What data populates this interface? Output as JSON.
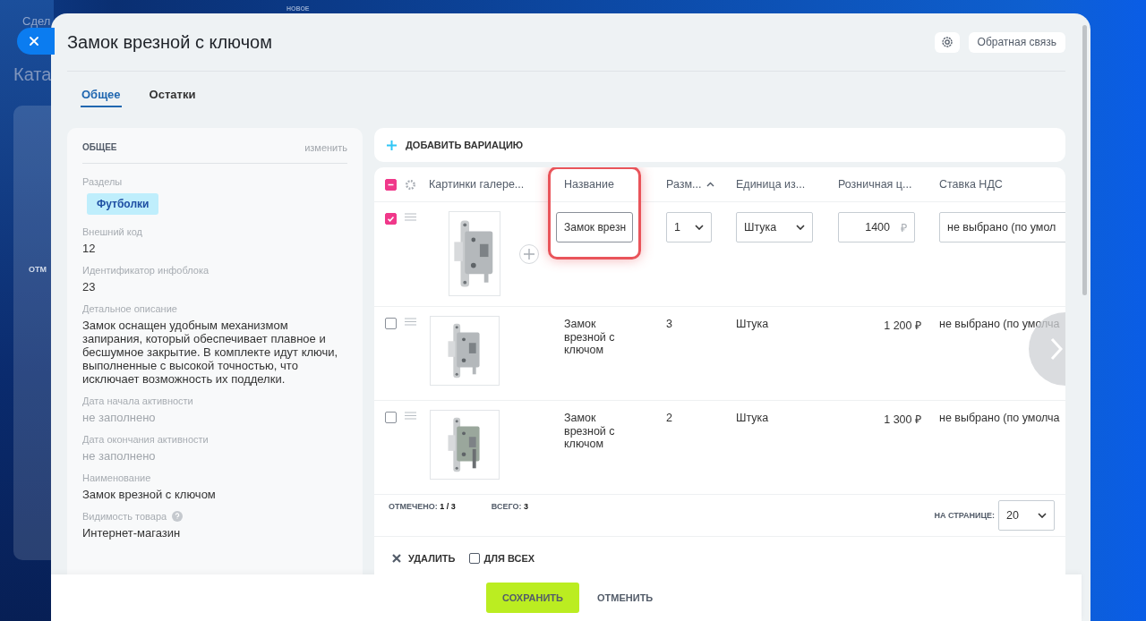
{
  "background_page": {
    "breadcrumb": "Сдел",
    "badge": "НОВОЕ",
    "heading": "Ката",
    "column": "ОТМ"
  },
  "panel": {
    "title": "Замок врезной с ключом",
    "feedback_button": "Обратная связь"
  },
  "tabs": [
    {
      "label": "Общее",
      "selected": true
    },
    {
      "label": "Остатки",
      "selected": false
    }
  ],
  "general_card": {
    "title": "ОБЩЕЕ",
    "edit_link": "изменить",
    "fields": [
      {
        "kind": "tags",
        "label": "Разделы",
        "tags": [
          "Футболки"
        ]
      },
      {
        "kind": "text",
        "label": "Внешний код",
        "value": "12"
      },
      {
        "kind": "text",
        "label": "Идентификатор инфоблока",
        "value": "23"
      },
      {
        "kind": "text",
        "label": "Детальное описание",
        "value": "Замок оснащен удобным механизмом запирания, который обеспечивает плавное и бесшумное закрытие. В комплекте идут ключи, выполненные с высокой точностью, что исключает возможность их подделки."
      },
      {
        "kind": "empty",
        "label": "Дата начала активности",
        "value": "не заполнено"
      },
      {
        "kind": "empty",
        "label": "Дата окончания активности",
        "value": "не заполнено"
      },
      {
        "kind": "text",
        "label": "Наименование",
        "value": "Замок врезной с ключом"
      },
      {
        "kind": "text",
        "label": "Видимость товара",
        "help": true,
        "value": "Интернет-магазин"
      }
    ]
  },
  "variations": {
    "add_button": "ДОБАВИТЬ ВАРИАЦИЮ",
    "header_checkbox": {
      "indeterminate": true
    },
    "columns": [
      {
        "label": "Картинки галере...",
        "highlighted": false,
        "sort": false
      },
      {
        "label": "Название",
        "highlighted": true,
        "sort": false
      },
      {
        "label": "Разм...",
        "highlighted": false,
        "sort": true
      },
      {
        "label": "Единица из...",
        "highlighted": false,
        "sort": false
      },
      {
        "label": "Розничная ц...",
        "highlighted": false,
        "sort": false
      },
      {
        "label": "Ставка НДС",
        "highlighted": false,
        "sort": false
      }
    ],
    "rows": [
      {
        "selected": true,
        "editing": true,
        "name": "Замок врезн",
        "size": "1",
        "unit": "Штука",
        "price": "1400",
        "currency": "₽",
        "vat": "не выбрано (по умол"
      },
      {
        "selected": false,
        "editing": false,
        "name": "Замок врезной с ключом",
        "size": "3",
        "unit": "Штука",
        "price": "1 200 ₽",
        "vat": "не выбрано (по умолча"
      },
      {
        "selected": false,
        "editing": false,
        "name": "Замок врезной с ключом",
        "size": "2",
        "unit": "Штука",
        "price": "1 300 ₽",
        "vat": "не выбрано (по умолча"
      }
    ],
    "summary": {
      "checked_label": "ОТМЕЧЕНО:",
      "checked_value": "1 / 3",
      "total_label": "ВСЕГО:",
      "total_value": "3",
      "per_page_label": "НА СТРАНИЦЕ:",
      "per_page": "20"
    },
    "actions": {
      "delete": "УДАЛИТЬ",
      "for_all": {
        "label": "ДЛЯ ВСЕХ",
        "checked": false
      }
    }
  },
  "footer": {
    "save": "СОХРАНИТЬ",
    "cancel": "ОТМЕНИТЬ"
  }
}
